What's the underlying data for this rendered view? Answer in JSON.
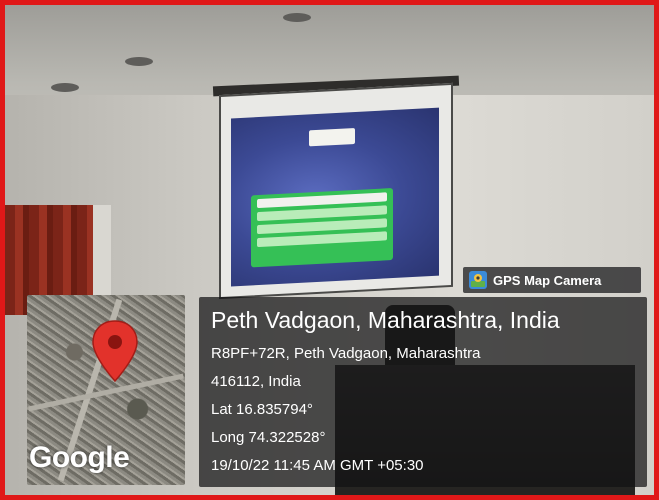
{
  "overlay_badge": {
    "label": "GPS Map Camera",
    "icon": "gps-map-camera-app-icon",
    "colors": {
      "icon_bg": "#3b8bd9",
      "icon_fg": "#f4c542"
    }
  },
  "location": {
    "title": "Peth Vadgaon, Maharashtra, India",
    "address_line1": "R8PF+72R, Peth Vadgaon, Maharashtra",
    "address_line2": "416112, India",
    "latitude": "Lat 16.835794°",
    "longitude": "Long 74.322528°",
    "timestamp": "19/10/22 11:45 AM GMT +05:30"
  },
  "map": {
    "watermark": "Google",
    "pin_icon": "map-pin-icon",
    "pin_color": "#e2322b"
  },
  "frame_color": "#e01818"
}
